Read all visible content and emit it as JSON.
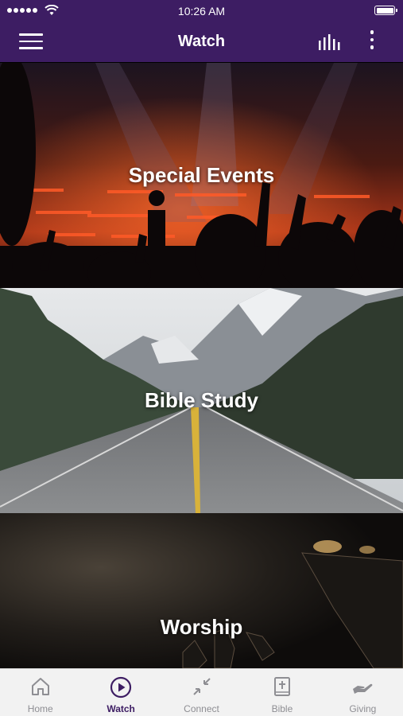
{
  "status_bar": {
    "time": "10:26 AM",
    "battery_level": 1.0
  },
  "nav": {
    "title": "Watch",
    "menu_icon": "hamburger-menu-icon",
    "bars_icon": "equalizer-bars-icon",
    "more_icon": "vertical-dots-icon"
  },
  "cards": [
    {
      "label": "Special Events"
    },
    {
      "label": "Bible Study"
    },
    {
      "label": "Worship"
    }
  ],
  "tabs": [
    {
      "label": "Home",
      "icon": "home-icon",
      "active": false
    },
    {
      "label": "Watch",
      "icon": "play-circle-icon",
      "active": true
    },
    {
      "label": "Connect",
      "icon": "connect-arrows-icon",
      "active": false
    },
    {
      "label": "Bible",
      "icon": "bible-book-icon",
      "active": false
    },
    {
      "label": "Giving",
      "icon": "giving-hand-icon",
      "active": false
    }
  ],
  "colors": {
    "brand": "#3d1d63",
    "tab_inactive": "#8e8e93",
    "tab_active": "#3d1d63"
  }
}
